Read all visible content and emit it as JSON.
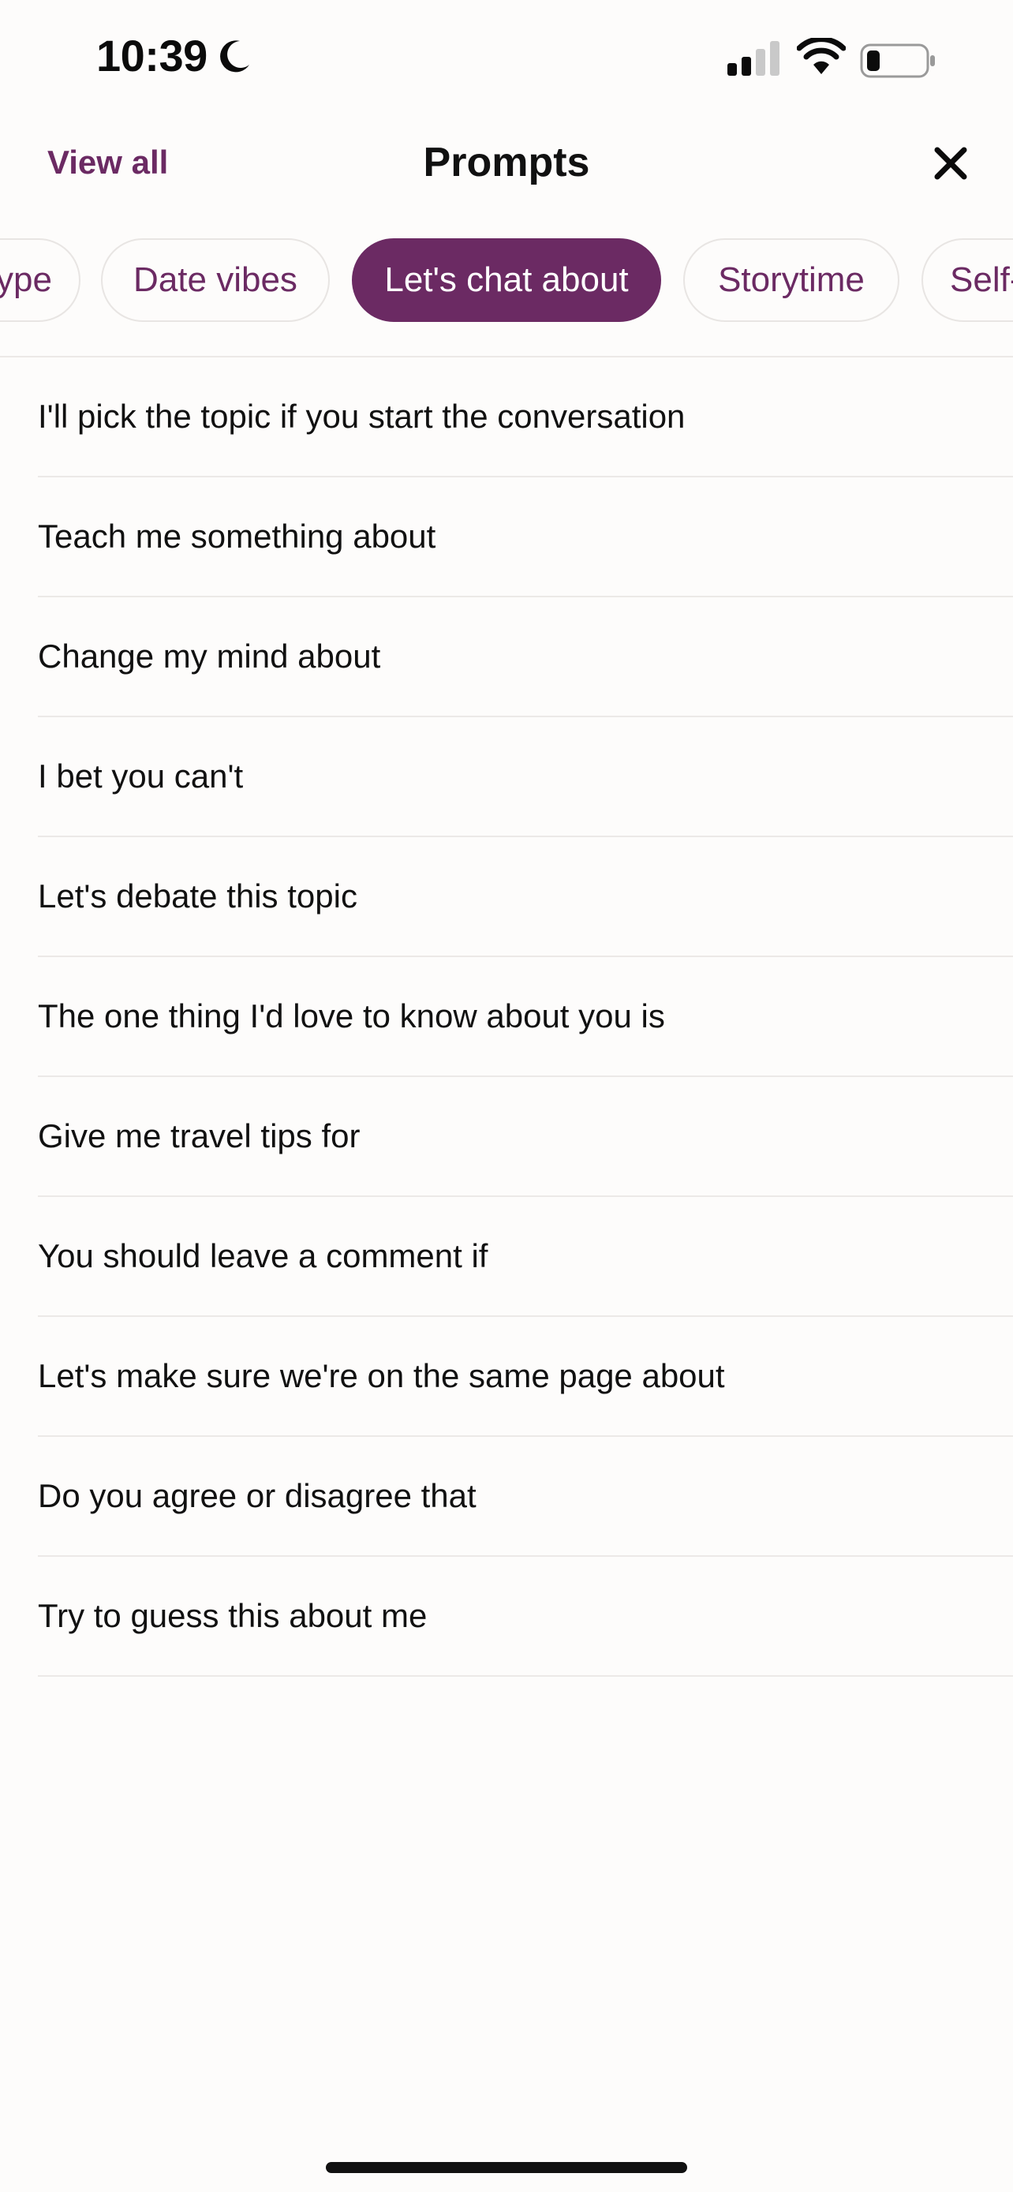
{
  "status_bar": {
    "time": "10:39",
    "icons": [
      "moon-icon",
      "cellular-signal-icon",
      "wifi-icon",
      "battery-icon"
    ]
  },
  "header": {
    "view_all_label": "View all",
    "title": "Prompts",
    "close_icon": "close-icon"
  },
  "chips": [
    {
      "label": "ype",
      "active": false
    },
    {
      "label": "Date vibes",
      "active": false
    },
    {
      "label": "Let's chat about",
      "active": true
    },
    {
      "label": "Storytime",
      "active": false
    },
    {
      "label": "Self-",
      "active": false
    }
  ],
  "prompts": [
    "I'll pick the topic if you start the conversation",
    "Teach me something about",
    "Change my mind about",
    "I bet you can't",
    "Let's debate this topic",
    "The one thing I'd love to know about you is",
    "Give me travel tips for",
    "You should leave a comment if",
    "Let's make sure we're on the same page about",
    "Do you agree or disagree that",
    "Try to guess this about me"
  ],
  "colors": {
    "accent": "#6b2a63",
    "background": "#fdfcfb",
    "divider": "#ece9e7",
    "text": "#111111"
  }
}
